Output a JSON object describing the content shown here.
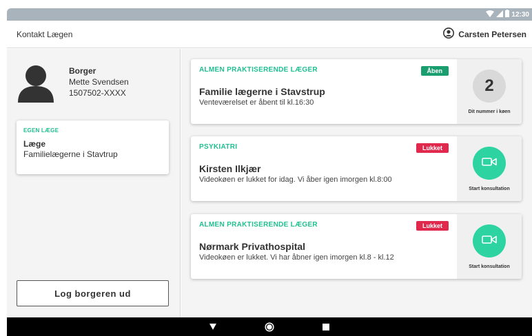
{
  "statusbar": {
    "time": "12:30"
  },
  "appbar": {
    "title": "Kontakt Lægen",
    "user_name": "Carsten Petersen"
  },
  "citizen": {
    "label": "Borger",
    "name": "Mette Svendsen",
    "cpr": "1507502-XXXX"
  },
  "own_doctor": {
    "tag": "EGEN LÆGE",
    "label": "Læge",
    "value": "Familielægerne i Stavtrup"
  },
  "logout_label": "Log borgeren ud",
  "cards": [
    {
      "category": "ALMEN PRAKTISERENDE LÆGER",
      "badge": "Åben",
      "name": "Familie lægerne i Stavstrup",
      "description": "Venteværelset er åbent til kl.16:30",
      "queue_number": "2",
      "side_label": "Dit nummer i køen"
    },
    {
      "category": "PSYKIATRI",
      "badge": "Lukket",
      "name": "Kirsten Ilkjær",
      "description": "Videokøen er lukket for idag. Vi åber igen imorgen kl.8:00",
      "side_label": "Start konsultation"
    },
    {
      "category": "ALMEN PRAKTISERENDE LÆGER",
      "badge": "Lukket",
      "name": "Nørmark Privathospital",
      "description": "Videokøen er lukket. Vi har åbner igen imorgen kl.8 - kl.12",
      "side_label": "Start konsultation"
    }
  ],
  "colors": {
    "accent_green": "#1fbf8f",
    "open_badge": "#1a9e6f",
    "closed_badge": "#e0294d",
    "video_button": "#2ed3a2"
  },
  "icons": [
    "wifi-icon",
    "signal-icon",
    "battery-icon",
    "user-icon",
    "avatar-icon",
    "video-camera-icon",
    "back-icon",
    "home-icon",
    "recents-icon"
  ]
}
